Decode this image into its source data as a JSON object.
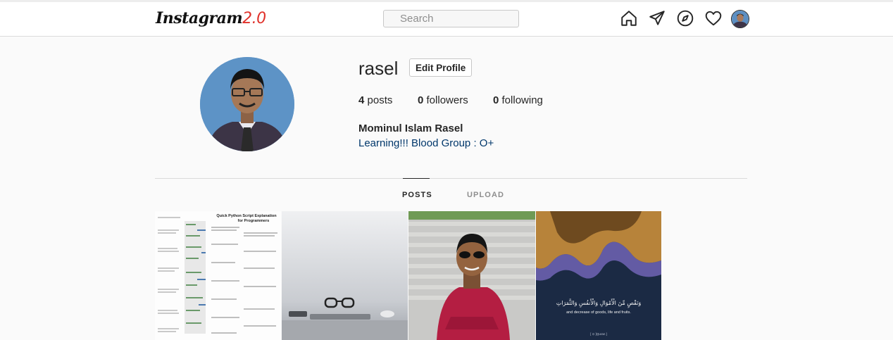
{
  "navbar": {
    "logo_text": "Instagram",
    "logo_version": "2.0",
    "search_placeholder": "Search",
    "icons": [
      "home-icon",
      "send-icon",
      "explore-icon",
      "heart-icon",
      "avatar"
    ]
  },
  "profile": {
    "username": "rasel",
    "edit_label": "Edit Profile",
    "posts_count": "4",
    "posts_label": "posts",
    "followers_count": "0",
    "followers_label": "followers",
    "following_count": "0",
    "following_label": "following",
    "full_name": "Mominul Islam Rasel",
    "bio": "Learning!!! Blood Group : O+"
  },
  "tabs": [
    {
      "label": "POSTS",
      "active": true
    },
    {
      "label": "UPLOAD",
      "active": false
    }
  ],
  "posts": [
    {
      "kind": "document",
      "title_line1": "Quick Python Script Explanation",
      "title_line2": "for Programmers"
    },
    {
      "kind": "glasses-laptop"
    },
    {
      "kind": "portrait-red-shirt"
    },
    {
      "kind": "quran-verse",
      "arabic": "وَنَقْصٍ مِّنَ الْأَمْوَالِ وَالْأَنفُسِ وَالثَّمَرَاتِ",
      "english": "and decrease of goods, life and fruits.",
      "credit": "[ ⊙ ]Quran ]"
    }
  ],
  "colors": {
    "logo_version": "#e0322b",
    "bio_text": "#00376b",
    "background": "#fafafa"
  }
}
